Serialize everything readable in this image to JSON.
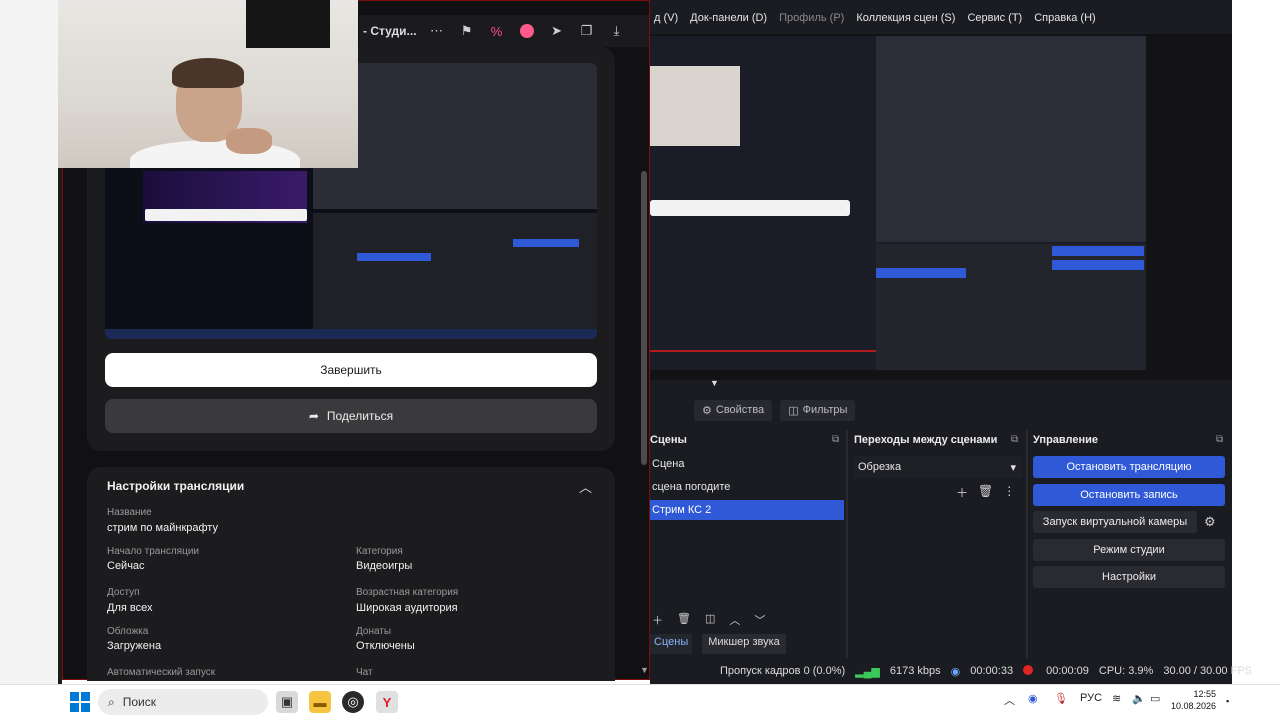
{
  "browser": {
    "title": "- Студи...",
    "stream": {
      "finish_button": "Завершить",
      "share_button": "Поделиться"
    },
    "settings": {
      "title": "Настройки трансляции",
      "fields": {
        "name_label": "Название",
        "name_value": "стрим по майнкрафту",
        "start_label": "Начало трансляции",
        "start_value": "Сейчас",
        "category_label": "Категория",
        "category_value": "Видеоигры",
        "access_label": "Доступ",
        "access_value": "Для всех",
        "age_label": "Возрастная категория",
        "age_value": "Широкая аудитория",
        "cover_label": "Обложка",
        "cover_value": "Загружена",
        "donations_label": "Донаты",
        "donations_value": "Отключены",
        "autostart_label": "Автоматический запуск",
        "chat_label": "Чат"
      }
    }
  },
  "obs": {
    "menu": {
      "item_view": "д (V)",
      "item_docks": "Док-панели (D)",
      "item_profile": "Профиль (P)",
      "item_collection": "Коллекция сцен (S)",
      "item_tools": "Сервис (T)",
      "item_help": "Справка (H)"
    },
    "tabs": {
      "properties": "Свойства",
      "filters": "Фильтры"
    },
    "scenes": {
      "header": "Сцены",
      "items": [
        "Сцена",
        "сцена погодите",
        "Стрим КС 2"
      ],
      "active_index": 2
    },
    "transitions": {
      "header": "Переходы между сценами",
      "selected": "Обрезка"
    },
    "controls": {
      "header": "Управление",
      "stop_stream": "Остановить трансляцию",
      "stop_record": "Остановить запись",
      "virtual_cam": "Запуск виртуальной камеры",
      "studio_mode": "Режим студии",
      "settings": "Настройки"
    },
    "bottom_tabs": {
      "scenes": "Сцены",
      "mixer": "Микшер звука"
    },
    "status": {
      "dropped": "Пропуск кадров 0 (0.0%)",
      "bitrate": "6173 kbps",
      "stream_time": "00:00:33",
      "record_time": "00:00:09",
      "cpu": "CPU: 3.9%",
      "fps": "30.00 / 30.00 FPS"
    }
  },
  "taskbar": {
    "search_placeholder": "Поиск",
    "lang": "РУС",
    "time": "12:55",
    "date": "10.08.2026"
  },
  "colors": {
    "obs_bg": "#1b1c21",
    "accent_blue": "#2f59d6",
    "browser_bg": "#111113",
    "record_red": "#e02424",
    "bitrate_green": "#3cc85a"
  }
}
